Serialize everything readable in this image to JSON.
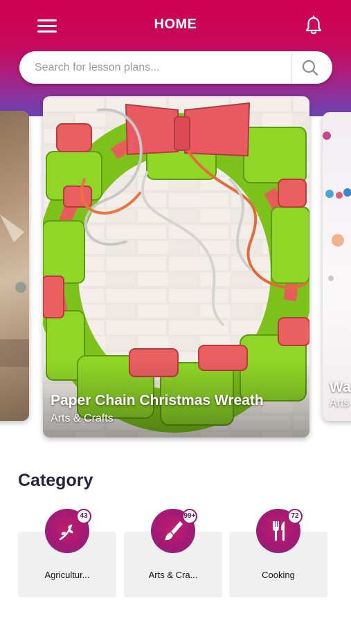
{
  "header": {
    "title": "HOME",
    "menu_icon": "hamburger-menu-icon",
    "notification_icon": "bell-icon"
  },
  "search": {
    "placeholder": "Search for lesson plans...",
    "value": "",
    "icon": "search-icon"
  },
  "carousel": {
    "cards": [
      {
        "title": "",
        "subtitle": ""
      },
      {
        "title": "Paper Chain Christmas Wreath",
        "subtitle": "Arts & Crafts"
      },
      {
        "title": "Wa",
        "subtitle": "Arts"
      }
    ]
  },
  "category": {
    "heading": "Category",
    "items": [
      {
        "label": "Agricultur...",
        "count": "43",
        "icon": "plant-sprout-icon"
      },
      {
        "label": "Arts & Cra...",
        "count": "99+",
        "icon": "paintbrush-icon"
      },
      {
        "label": "Cooking",
        "count": "72",
        "icon": "fork-knife-icon"
      }
    ]
  },
  "colors": {
    "brand_primary": "#d0004f",
    "brand_secondary": "#6e44b2",
    "category_circle": "#a01a74",
    "heading_text": "#2a2340"
  }
}
